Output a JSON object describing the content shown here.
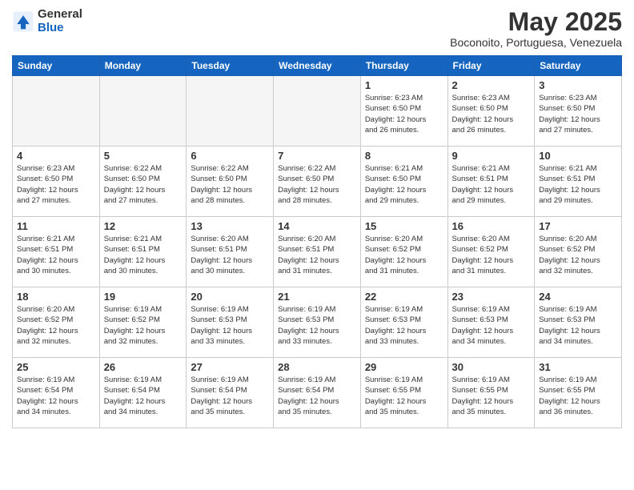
{
  "logo": {
    "general": "General",
    "blue": "Blue"
  },
  "title": "May 2025",
  "subtitle": "Boconoito, Portuguesa, Venezuela",
  "days_header": [
    "Sunday",
    "Monday",
    "Tuesday",
    "Wednesday",
    "Thursday",
    "Friday",
    "Saturday"
  ],
  "weeks": [
    [
      {
        "num": "",
        "info": ""
      },
      {
        "num": "",
        "info": ""
      },
      {
        "num": "",
        "info": ""
      },
      {
        "num": "",
        "info": ""
      },
      {
        "num": "1",
        "info": "Sunrise: 6:23 AM\nSunset: 6:50 PM\nDaylight: 12 hours\nand 26 minutes."
      },
      {
        "num": "2",
        "info": "Sunrise: 6:23 AM\nSunset: 6:50 PM\nDaylight: 12 hours\nand 26 minutes."
      },
      {
        "num": "3",
        "info": "Sunrise: 6:23 AM\nSunset: 6:50 PM\nDaylight: 12 hours\nand 27 minutes."
      }
    ],
    [
      {
        "num": "4",
        "info": "Sunrise: 6:23 AM\nSunset: 6:50 PM\nDaylight: 12 hours\nand 27 minutes."
      },
      {
        "num": "5",
        "info": "Sunrise: 6:22 AM\nSunset: 6:50 PM\nDaylight: 12 hours\nand 27 minutes."
      },
      {
        "num": "6",
        "info": "Sunrise: 6:22 AM\nSunset: 6:50 PM\nDaylight: 12 hours\nand 28 minutes."
      },
      {
        "num": "7",
        "info": "Sunrise: 6:22 AM\nSunset: 6:50 PM\nDaylight: 12 hours\nand 28 minutes."
      },
      {
        "num": "8",
        "info": "Sunrise: 6:21 AM\nSunset: 6:50 PM\nDaylight: 12 hours\nand 29 minutes."
      },
      {
        "num": "9",
        "info": "Sunrise: 6:21 AM\nSunset: 6:51 PM\nDaylight: 12 hours\nand 29 minutes."
      },
      {
        "num": "10",
        "info": "Sunrise: 6:21 AM\nSunset: 6:51 PM\nDaylight: 12 hours\nand 29 minutes."
      }
    ],
    [
      {
        "num": "11",
        "info": "Sunrise: 6:21 AM\nSunset: 6:51 PM\nDaylight: 12 hours\nand 30 minutes."
      },
      {
        "num": "12",
        "info": "Sunrise: 6:21 AM\nSunset: 6:51 PM\nDaylight: 12 hours\nand 30 minutes."
      },
      {
        "num": "13",
        "info": "Sunrise: 6:20 AM\nSunset: 6:51 PM\nDaylight: 12 hours\nand 30 minutes."
      },
      {
        "num": "14",
        "info": "Sunrise: 6:20 AM\nSunset: 6:51 PM\nDaylight: 12 hours\nand 31 minutes."
      },
      {
        "num": "15",
        "info": "Sunrise: 6:20 AM\nSunset: 6:52 PM\nDaylight: 12 hours\nand 31 minutes."
      },
      {
        "num": "16",
        "info": "Sunrise: 6:20 AM\nSunset: 6:52 PM\nDaylight: 12 hours\nand 31 minutes."
      },
      {
        "num": "17",
        "info": "Sunrise: 6:20 AM\nSunset: 6:52 PM\nDaylight: 12 hours\nand 32 minutes."
      }
    ],
    [
      {
        "num": "18",
        "info": "Sunrise: 6:20 AM\nSunset: 6:52 PM\nDaylight: 12 hours\nand 32 minutes."
      },
      {
        "num": "19",
        "info": "Sunrise: 6:19 AM\nSunset: 6:52 PM\nDaylight: 12 hours\nand 32 minutes."
      },
      {
        "num": "20",
        "info": "Sunrise: 6:19 AM\nSunset: 6:53 PM\nDaylight: 12 hours\nand 33 minutes."
      },
      {
        "num": "21",
        "info": "Sunrise: 6:19 AM\nSunset: 6:53 PM\nDaylight: 12 hours\nand 33 minutes."
      },
      {
        "num": "22",
        "info": "Sunrise: 6:19 AM\nSunset: 6:53 PM\nDaylight: 12 hours\nand 33 minutes."
      },
      {
        "num": "23",
        "info": "Sunrise: 6:19 AM\nSunset: 6:53 PM\nDaylight: 12 hours\nand 34 minutes."
      },
      {
        "num": "24",
        "info": "Sunrise: 6:19 AM\nSunset: 6:53 PM\nDaylight: 12 hours\nand 34 minutes."
      }
    ],
    [
      {
        "num": "25",
        "info": "Sunrise: 6:19 AM\nSunset: 6:54 PM\nDaylight: 12 hours\nand 34 minutes."
      },
      {
        "num": "26",
        "info": "Sunrise: 6:19 AM\nSunset: 6:54 PM\nDaylight: 12 hours\nand 34 minutes."
      },
      {
        "num": "27",
        "info": "Sunrise: 6:19 AM\nSunset: 6:54 PM\nDaylight: 12 hours\nand 35 minutes."
      },
      {
        "num": "28",
        "info": "Sunrise: 6:19 AM\nSunset: 6:54 PM\nDaylight: 12 hours\nand 35 minutes."
      },
      {
        "num": "29",
        "info": "Sunrise: 6:19 AM\nSunset: 6:55 PM\nDaylight: 12 hours\nand 35 minutes."
      },
      {
        "num": "30",
        "info": "Sunrise: 6:19 AM\nSunset: 6:55 PM\nDaylight: 12 hours\nand 35 minutes."
      },
      {
        "num": "31",
        "info": "Sunrise: 6:19 AM\nSunset: 6:55 PM\nDaylight: 12 hours\nand 36 minutes."
      }
    ]
  ]
}
